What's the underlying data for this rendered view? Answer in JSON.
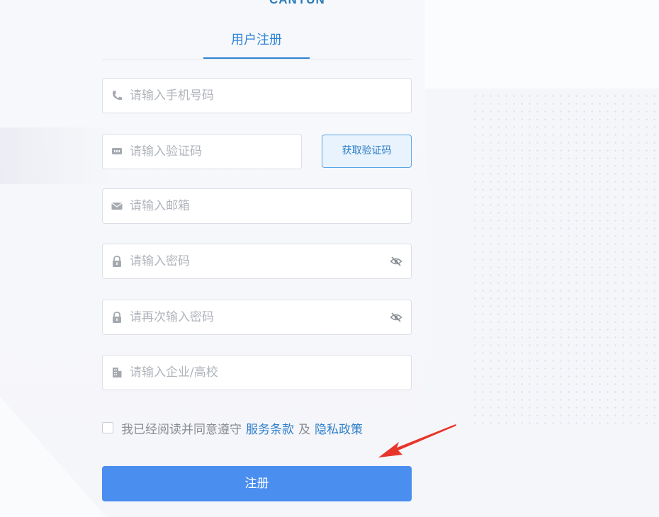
{
  "logo": {
    "text": "CANYUN",
    "colors": {
      "blue": "#2c7ab8",
      "green": "#5dbb3c"
    }
  },
  "tabs": [
    {
      "label": "用户注册",
      "active": true
    }
  ],
  "form": {
    "phone": {
      "placeholder": "请输入手机号码",
      "icon": "phone-icon"
    },
    "code": {
      "placeholder": "请输入验证码",
      "icon": "sms-icon"
    },
    "get_code_label": "获取验证码",
    "email": {
      "placeholder": "请输入邮箱",
      "icon": "mail-icon"
    },
    "password": {
      "placeholder": "请输入密码",
      "icon": "lock-icon"
    },
    "confirm_password": {
      "placeholder": "请再次输入密码",
      "icon": "lock-icon"
    },
    "organization": {
      "placeholder": "请输入企业/高校",
      "icon": "building-icon"
    }
  },
  "agreement": {
    "prefix": "我已经阅读并同意遵守",
    "terms": "服务条款",
    "and": "及",
    "privacy": "隐私政策",
    "checked": false
  },
  "submit_label": "注册",
  "colors": {
    "primary": "#4a8ef0",
    "link": "#2f7fc9",
    "annotation_arrow": "#e8352b"
  }
}
